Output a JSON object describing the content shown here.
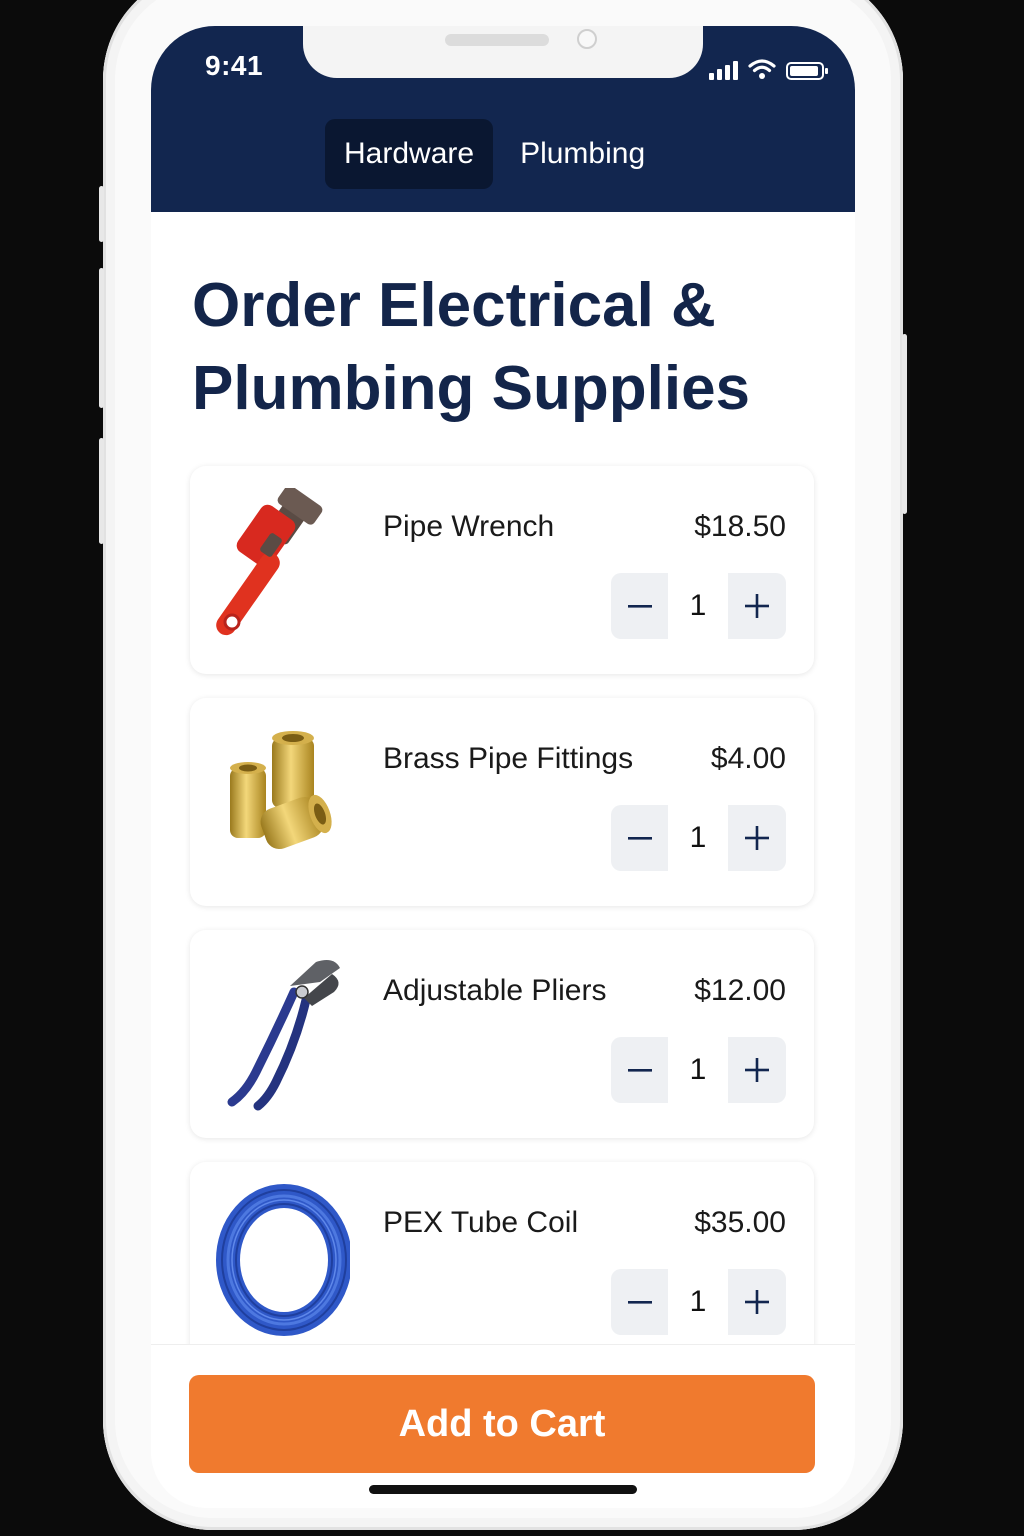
{
  "status_bar": {
    "time": "9:41"
  },
  "tabs": [
    {
      "label": "Hardware",
      "active": true
    },
    {
      "label": "Plumbing",
      "active": false
    }
  ],
  "page": {
    "title_line1": "Order Electrical &",
    "title_line2": "Plumbing Supplies"
  },
  "products": [
    {
      "name": "Pipe Wrench",
      "price": "$18.50",
      "qty": "1",
      "icon": "pipe-wrench-icon"
    },
    {
      "name": "Brass Pipe Fittings",
      "price": "$4.00",
      "qty": "1",
      "icon": "brass-fittings-icon"
    },
    {
      "name": "Adjustable Pliers",
      "price": "$12.00",
      "qty": "1",
      "icon": "pliers-icon"
    },
    {
      "name": "PEX Tube Coil",
      "price": "$35.00",
      "qty": "1",
      "icon": "tube-coil-icon"
    }
  ],
  "cta": {
    "label": "Add to Cart"
  },
  "colors": {
    "header_bg": "#12264f",
    "title_text": "#13254a",
    "accent": "#f07a2e",
    "stepper_icon": "#12264f"
  }
}
